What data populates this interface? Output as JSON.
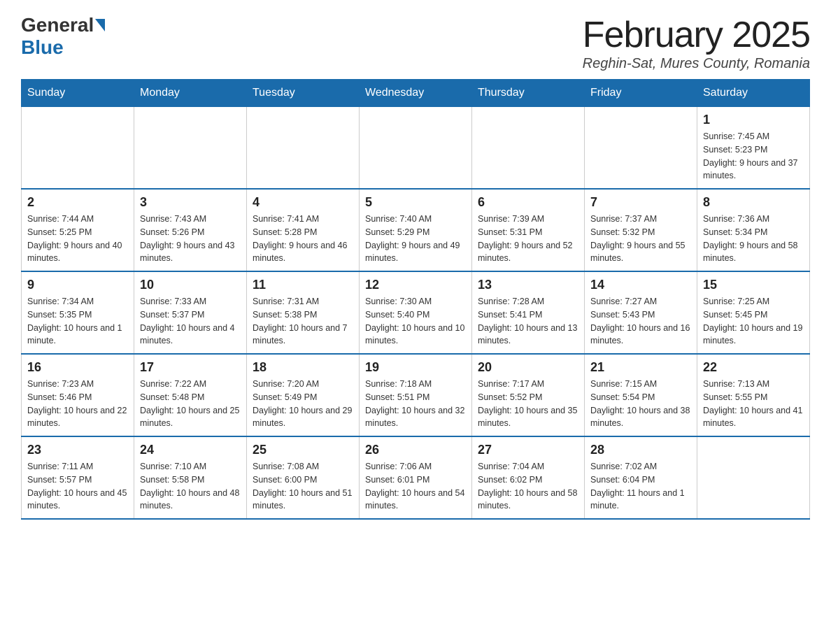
{
  "header": {
    "logo_general": "General",
    "logo_blue": "Blue",
    "month_title": "February 2025",
    "location": "Reghin-Sat, Mures County, Romania"
  },
  "days_of_week": [
    "Sunday",
    "Monday",
    "Tuesday",
    "Wednesday",
    "Thursday",
    "Friday",
    "Saturday"
  ],
  "weeks": [
    {
      "days": [
        {
          "num": "",
          "info": ""
        },
        {
          "num": "",
          "info": ""
        },
        {
          "num": "",
          "info": ""
        },
        {
          "num": "",
          "info": ""
        },
        {
          "num": "",
          "info": ""
        },
        {
          "num": "",
          "info": ""
        },
        {
          "num": "1",
          "info": "Sunrise: 7:45 AM\nSunset: 5:23 PM\nDaylight: 9 hours and 37 minutes."
        }
      ]
    },
    {
      "days": [
        {
          "num": "2",
          "info": "Sunrise: 7:44 AM\nSunset: 5:25 PM\nDaylight: 9 hours and 40 minutes."
        },
        {
          "num": "3",
          "info": "Sunrise: 7:43 AM\nSunset: 5:26 PM\nDaylight: 9 hours and 43 minutes."
        },
        {
          "num": "4",
          "info": "Sunrise: 7:41 AM\nSunset: 5:28 PM\nDaylight: 9 hours and 46 minutes."
        },
        {
          "num": "5",
          "info": "Sunrise: 7:40 AM\nSunset: 5:29 PM\nDaylight: 9 hours and 49 minutes."
        },
        {
          "num": "6",
          "info": "Sunrise: 7:39 AM\nSunset: 5:31 PM\nDaylight: 9 hours and 52 minutes."
        },
        {
          "num": "7",
          "info": "Sunrise: 7:37 AM\nSunset: 5:32 PM\nDaylight: 9 hours and 55 minutes."
        },
        {
          "num": "8",
          "info": "Sunrise: 7:36 AM\nSunset: 5:34 PM\nDaylight: 9 hours and 58 minutes."
        }
      ]
    },
    {
      "days": [
        {
          "num": "9",
          "info": "Sunrise: 7:34 AM\nSunset: 5:35 PM\nDaylight: 10 hours and 1 minute."
        },
        {
          "num": "10",
          "info": "Sunrise: 7:33 AM\nSunset: 5:37 PM\nDaylight: 10 hours and 4 minutes."
        },
        {
          "num": "11",
          "info": "Sunrise: 7:31 AM\nSunset: 5:38 PM\nDaylight: 10 hours and 7 minutes."
        },
        {
          "num": "12",
          "info": "Sunrise: 7:30 AM\nSunset: 5:40 PM\nDaylight: 10 hours and 10 minutes."
        },
        {
          "num": "13",
          "info": "Sunrise: 7:28 AM\nSunset: 5:41 PM\nDaylight: 10 hours and 13 minutes."
        },
        {
          "num": "14",
          "info": "Sunrise: 7:27 AM\nSunset: 5:43 PM\nDaylight: 10 hours and 16 minutes."
        },
        {
          "num": "15",
          "info": "Sunrise: 7:25 AM\nSunset: 5:45 PM\nDaylight: 10 hours and 19 minutes."
        }
      ]
    },
    {
      "days": [
        {
          "num": "16",
          "info": "Sunrise: 7:23 AM\nSunset: 5:46 PM\nDaylight: 10 hours and 22 minutes."
        },
        {
          "num": "17",
          "info": "Sunrise: 7:22 AM\nSunset: 5:48 PM\nDaylight: 10 hours and 25 minutes."
        },
        {
          "num": "18",
          "info": "Sunrise: 7:20 AM\nSunset: 5:49 PM\nDaylight: 10 hours and 29 minutes."
        },
        {
          "num": "19",
          "info": "Sunrise: 7:18 AM\nSunset: 5:51 PM\nDaylight: 10 hours and 32 minutes."
        },
        {
          "num": "20",
          "info": "Sunrise: 7:17 AM\nSunset: 5:52 PM\nDaylight: 10 hours and 35 minutes."
        },
        {
          "num": "21",
          "info": "Sunrise: 7:15 AM\nSunset: 5:54 PM\nDaylight: 10 hours and 38 minutes."
        },
        {
          "num": "22",
          "info": "Sunrise: 7:13 AM\nSunset: 5:55 PM\nDaylight: 10 hours and 41 minutes."
        }
      ]
    },
    {
      "days": [
        {
          "num": "23",
          "info": "Sunrise: 7:11 AM\nSunset: 5:57 PM\nDaylight: 10 hours and 45 minutes."
        },
        {
          "num": "24",
          "info": "Sunrise: 7:10 AM\nSunset: 5:58 PM\nDaylight: 10 hours and 48 minutes."
        },
        {
          "num": "25",
          "info": "Sunrise: 7:08 AM\nSunset: 6:00 PM\nDaylight: 10 hours and 51 minutes."
        },
        {
          "num": "26",
          "info": "Sunrise: 7:06 AM\nSunset: 6:01 PM\nDaylight: 10 hours and 54 minutes."
        },
        {
          "num": "27",
          "info": "Sunrise: 7:04 AM\nSunset: 6:02 PM\nDaylight: 10 hours and 58 minutes."
        },
        {
          "num": "28",
          "info": "Sunrise: 7:02 AM\nSunset: 6:04 PM\nDaylight: 11 hours and 1 minute."
        },
        {
          "num": "",
          "info": ""
        }
      ]
    }
  ]
}
